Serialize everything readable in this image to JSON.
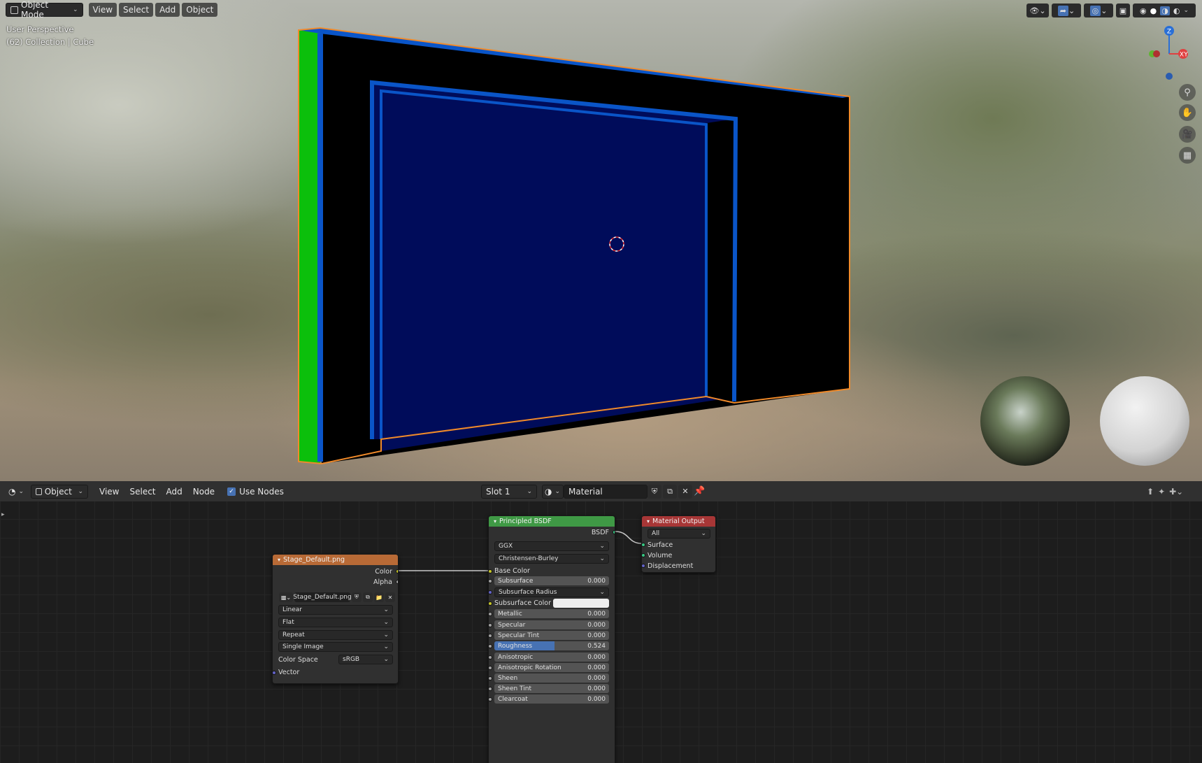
{
  "viewport": {
    "mode": "Object Mode",
    "menus": [
      "View",
      "Select",
      "Add",
      "Object"
    ],
    "perspective": "User Perspective",
    "collection": "(62) Collection | Cube",
    "gizmo": {
      "z": "Z",
      "x": "X",
      "y": "Y"
    },
    "colors": {
      "frame_outer": "#000000",
      "frame_inner": "#000c5a",
      "edge": "#0a55c8",
      "side": "#0bbf0b",
      "selection": "#f08a2a"
    }
  },
  "node_header": {
    "editor_type": "Object",
    "menus": [
      "View",
      "Select",
      "Add",
      "Node"
    ],
    "use_nodes": "Use Nodes",
    "slot": "Slot 1",
    "material": "Material"
  },
  "image_node": {
    "title": "Stage_Default.png",
    "out_color": "Color",
    "out_alpha": "Alpha",
    "image": "Stage_Default.png",
    "interpolation": "Linear",
    "projection": "Flat",
    "extension": "Repeat",
    "source": "Single Image",
    "colorspace_label": "Color Space",
    "colorspace": "sRGB",
    "vector": "Vector"
  },
  "bsdf_node": {
    "title": "Principled BSDF",
    "out": "BSDF",
    "distribution": "GGX",
    "subsurface_method": "Christensen-Burley",
    "base_color": "Base Color",
    "subsurface_radius": "Subsurface Radius",
    "subsurface_color": "Subsurface Color",
    "fields": [
      {
        "label": "Subsurface",
        "value": "0.000"
      },
      {
        "label": "Metallic",
        "value": "0.000"
      },
      {
        "label": "Specular",
        "value": "0.000"
      },
      {
        "label": "Specular Tint",
        "value": "0.000"
      },
      {
        "label": "Roughness",
        "value": "0.524",
        "fill": 0.524
      },
      {
        "label": "Anisotropic",
        "value": "0.000"
      },
      {
        "label": "Anisotropic Rotation",
        "value": "0.000"
      },
      {
        "label": "Sheen",
        "value": "0.000"
      },
      {
        "label": "Sheen Tint",
        "value": "0.000"
      },
      {
        "label": "Clearcoat",
        "value": "0.000"
      }
    ]
  },
  "output_node": {
    "title": "Material Output",
    "target": "All",
    "surface": "Surface",
    "volume": "Volume",
    "displacement": "Displacement"
  }
}
